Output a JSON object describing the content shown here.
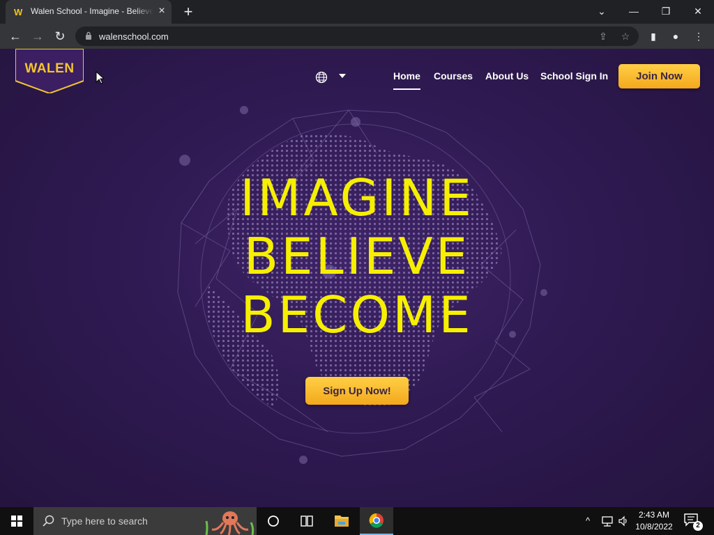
{
  "browser": {
    "tab": {
      "favicon": "W",
      "title": "Walen School - Imagine - Believe - Become",
      "close_icon": "×"
    },
    "new_tab_icon": "+",
    "window": {
      "dropdown_icon": "⌄",
      "minimize_icon": "—",
      "restore_icon": "❐",
      "close_icon": "✕"
    },
    "nav": {
      "back_icon": "←",
      "forward_icon": "→",
      "reload_icon": "↻"
    },
    "url": "walenschool.com",
    "icons": {
      "share": "⇪",
      "bookmark": "☆",
      "sidepanel": "▮",
      "profile": "●",
      "menu": "⋮"
    }
  },
  "site": {
    "logo_text": "WALEN",
    "nav": {
      "home": "Home",
      "courses": "Courses",
      "about": "About Us",
      "signin": "School Sign In"
    },
    "join_label": "Join Now",
    "hero": {
      "line1": "IMAGINE",
      "line2": "BELIEVE",
      "line3": "BECOME"
    },
    "signup_label": "Sign Up Now!",
    "colors": {
      "background": "#2f1a52",
      "hero_text": "#f6f000",
      "button": "#f9bd2f"
    }
  },
  "taskbar": {
    "search_placeholder": "Type here to search",
    "clock": {
      "time": "2:43 AM",
      "date": "10/8/2022"
    },
    "notification_count": "2",
    "tray": {
      "chevron": "^"
    }
  }
}
